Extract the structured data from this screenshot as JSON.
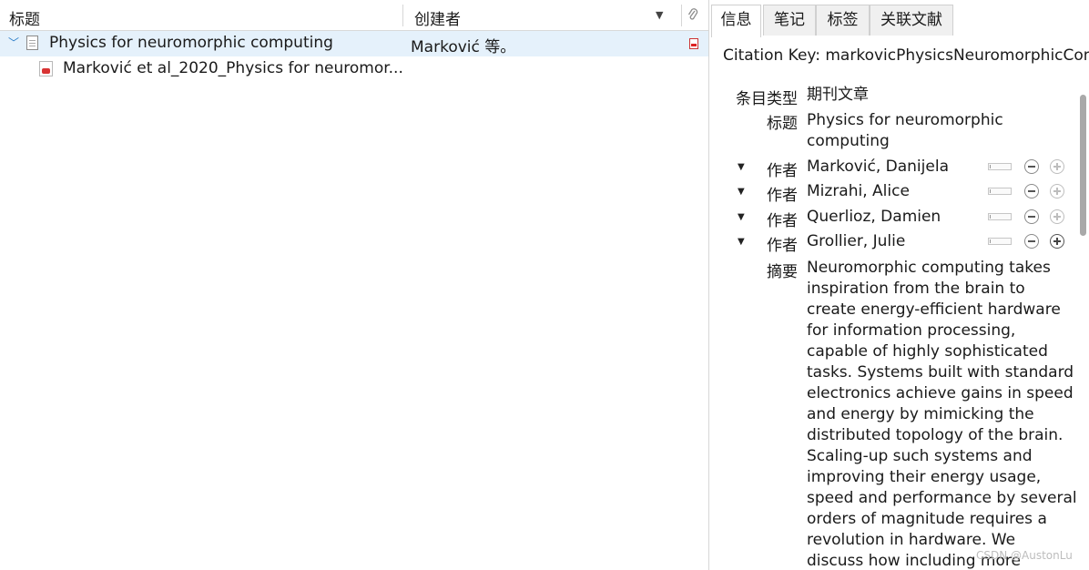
{
  "item_list": {
    "columns": {
      "title": "标题",
      "creator": "创建者"
    },
    "rows": [
      {
        "title": "Physics for neuromorphic computing",
        "creator": "Marković 等。"
      },
      {
        "title": "Marković et al_2020_Physics for neuromor..."
      }
    ]
  },
  "item_pane": {
    "tabs": [
      "信息",
      "笔记",
      "标签",
      "关联文献"
    ],
    "citation_key": "Citation Key: markovicPhysicsNeuromorphicCom",
    "fields": {
      "item_type_label": "条目类型",
      "item_type_value": "期刊文章",
      "title_label": "标题",
      "title_value": [
        "Physics for neuromorphic",
        "computing"
      ],
      "author_label": "作者",
      "authors": [
        "Marković, Danijela",
        "Mizrahi, Alice",
        "Querlioz, Damien",
        "Grollier, Julie"
      ],
      "abstract_label": "摘要",
      "abstract_lines": [
        "Neuromorphic computing takes",
        "inspiration from the brain to",
        "create energy-efficient hardware",
        "for information processing,",
        "capable of highly sophisticated",
        "tasks. Systems built with standard",
        "electronics achieve gains in speed",
        "and energy by mimicking the",
        "distributed topology of the brain.",
        "Scaling-up such systems and",
        "improving their energy usage,",
        "speed and performance by several",
        "orders of magnitude requires a",
        "revolution in hardware. We",
        "discuss how including more"
      ]
    }
  },
  "watermark": "CSDN @AustonLu"
}
